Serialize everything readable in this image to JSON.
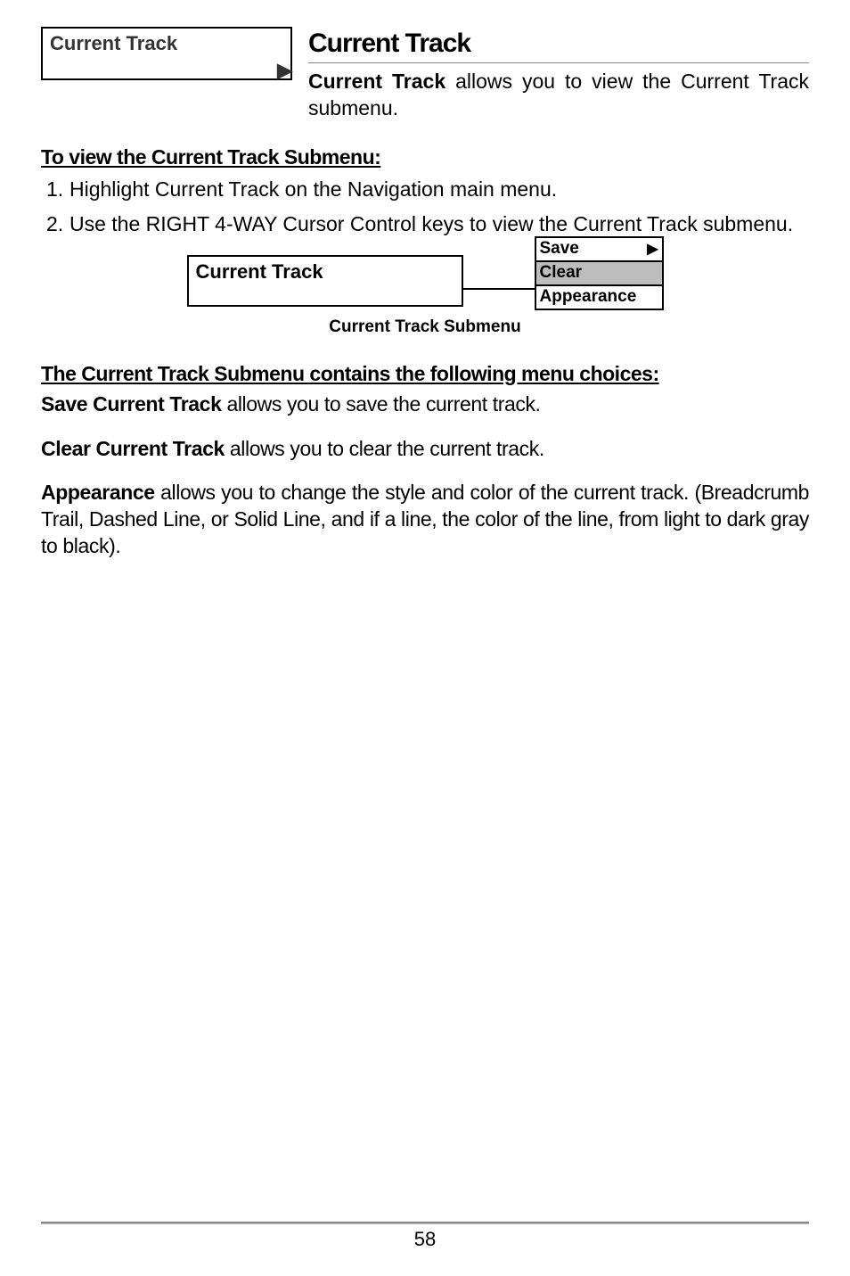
{
  "menuBox": {
    "label": "Current Track"
  },
  "title": "Current Track",
  "intro": {
    "strong": "Current Track",
    "rest": " allows you to view the Current Track submenu."
  },
  "viewHeading": "To view the Current Track Submenu:",
  "steps": [
    {
      "n": "1.",
      "t": "Highlight Current Track on the Navigation main menu."
    },
    {
      "n": "2.",
      "t": "Use the RIGHT 4-WAY Cursor Control keys to view the Current Track submenu."
    }
  ],
  "submenuFig": {
    "left": "Current Track",
    "rows": [
      "Save",
      "Clear",
      "Appearance"
    ],
    "caption": "Current Track Submenu"
  },
  "choicesHeading": "The Current Track Submenu contains the following menu choices:",
  "save": {
    "strong": "Save Current Track",
    "rest": " allows you to save the current track."
  },
  "clear": {
    "strong": "Clear Current Track",
    "rest": " allows you to clear the current track."
  },
  "appearance": {
    "strong": "Appearance",
    "rest": " allows you to change the style and color of the current track. (Breadcrumb Trail, Dashed Line, or Solid Line, and if a line, the color of the line, from light to dark gray to black)."
  },
  "pageNumber": "58"
}
